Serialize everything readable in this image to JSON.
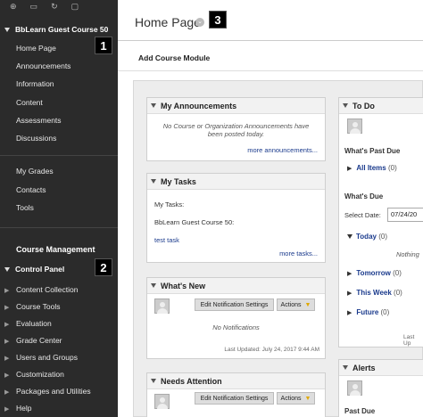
{
  "sidebar": {
    "course_title": "BbLearn Guest Course 50",
    "links": [
      "Home Page",
      "Announcements",
      "Information",
      "Content",
      "Assessments",
      "Discussions"
    ],
    "tools": [
      "My Grades",
      "Contacts",
      "Tools"
    ],
    "course_management": "Course Management",
    "control_panel": "Control Panel",
    "cp_items": [
      "Content Collection",
      "Course Tools",
      "Evaluation",
      "Grade Center",
      "Users and Groups",
      "Customization",
      "Packages and Utilities",
      "Help"
    ]
  },
  "badges": {
    "one": "1",
    "two": "2",
    "three": "3"
  },
  "header": {
    "page_title": "Home Page",
    "add_module": "Add Course Module"
  },
  "announcements": {
    "title": "My Announcements",
    "message_line1": "No Course or Organization Announcements have",
    "message_line2": "been posted today.",
    "more": "more announcements..."
  },
  "tasks": {
    "title": "My Tasks",
    "label": "My Tasks:",
    "course": "BbLearn Guest Course 50:",
    "task": "test task",
    "more": "more tasks..."
  },
  "whats_new": {
    "title": "What's New",
    "edit_btn": "Edit Notification Settings",
    "actions_btn": "Actions",
    "no_notif": "No Notifications",
    "updated": "Last Updated: July 24, 2017 9:44 AM"
  },
  "needs_attention": {
    "title": "Needs Attention",
    "edit_btn": "Edit Notification Settings",
    "actions_btn": "Actions"
  },
  "todo": {
    "title": "To Do",
    "past_due": "What's Past Due",
    "all_items": "All Items",
    "all_items_count": "(0)",
    "whats_due": "What's Due",
    "select_date_label": "Select Date:",
    "select_date_value": "07/24/20",
    "today": "Today",
    "today_count": "(0)",
    "nothing": "Nothing",
    "tomorrow": "Tomorrow",
    "tomorrow_count": "(0)",
    "this_week": "This Week",
    "this_week_count": "(0)",
    "future": "Future",
    "future_count": "(0)",
    "last_up": "Last Up"
  },
  "alerts": {
    "title": "Alerts",
    "past_due": "Past Due"
  },
  "colors": {
    "sidebar_bg": "#2b2b2b",
    "link": "#1a3a8c",
    "actions_chevron": "#e0a800"
  }
}
